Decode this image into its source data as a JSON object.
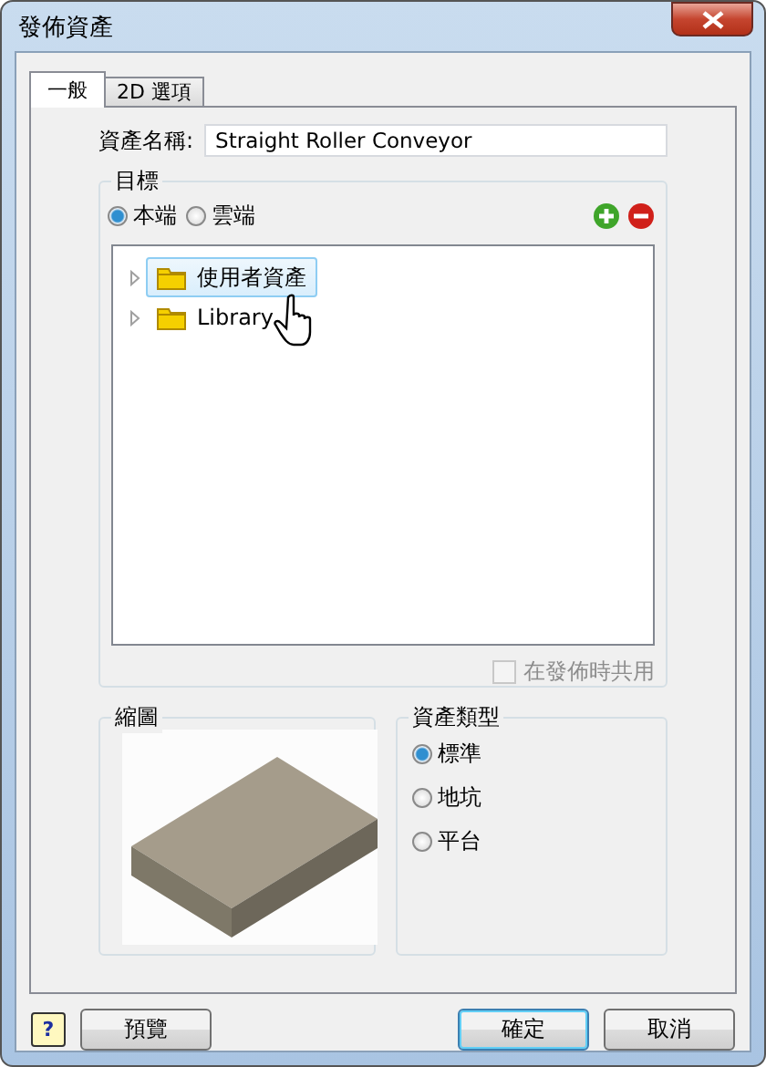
{
  "window": {
    "title": "發佈資產"
  },
  "tabs": [
    {
      "label": "一般",
      "selected": true
    },
    {
      "label": "2D 選項",
      "selected": false
    }
  ],
  "asset_name": {
    "label": "資產名稱:",
    "value": "Straight Roller Conveyor"
  },
  "target": {
    "title": "目標",
    "options": [
      {
        "label": "本端",
        "selected": true
      },
      {
        "label": "雲端",
        "selected": false
      }
    ],
    "tree": [
      {
        "label": "使用者資產",
        "selected": true,
        "expanded": false
      },
      {
        "label": "Library",
        "selected": false,
        "expanded": false
      }
    ],
    "share": {
      "label": "在發佈時共用",
      "checked": false,
      "disabled": true
    }
  },
  "thumbnail": {
    "title": "縮圖"
  },
  "asset_type": {
    "title": "資產類型",
    "options": [
      {
        "label": "標準",
        "selected": true
      },
      {
        "label": "地坑",
        "selected": false
      },
      {
        "label": "平台",
        "selected": false
      }
    ]
  },
  "buttons": {
    "help": "?",
    "preview": "預覽",
    "ok": "確定",
    "cancel": "取消"
  }
}
